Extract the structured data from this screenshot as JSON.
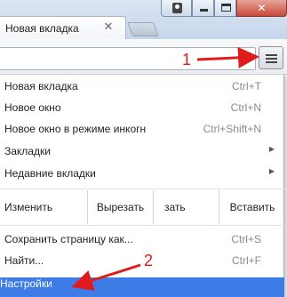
{
  "tab": {
    "title": "Новая вкладка",
    "close_icon": "close-icon"
  },
  "window_controls": {
    "icons": [
      "user-icon",
      "minimize-icon",
      "maximize-icon",
      "close-icon"
    ]
  },
  "toolbar": {
    "menu_icon": "hamburger-menu-icon"
  },
  "menu": {
    "items_group1": [
      {
        "label": "Новая вкладка",
        "shortcut": "Ctrl+T"
      },
      {
        "label": "Новое окно",
        "shortcut": "Ctrl+N"
      },
      {
        "label": "Новое окно в режиме инкогн",
        "shortcut": "Ctrl+Shift+N"
      },
      {
        "label": "Закладки",
        "shortcut": ""
      },
      {
        "label": "Недавние вкладки",
        "shortcut": ""
      }
    ],
    "edit": {
      "label": "Изменить",
      "cut": "Вырезать",
      "copy_partial": "зать",
      "paste": "Вставить"
    },
    "items_group2": [
      {
        "label": "Сохранить страницу как...",
        "shortcut": "Ctrl+S"
      },
      {
        "label": "Найти...",
        "shortcut": "Ctrl+F"
      }
    ],
    "settings": {
      "label": "Настройки"
    }
  },
  "annotations": {
    "marker1": "1",
    "marker2": "2",
    "color": "#e01b1b"
  },
  "colors": {
    "highlight": "#3d7be6"
  }
}
